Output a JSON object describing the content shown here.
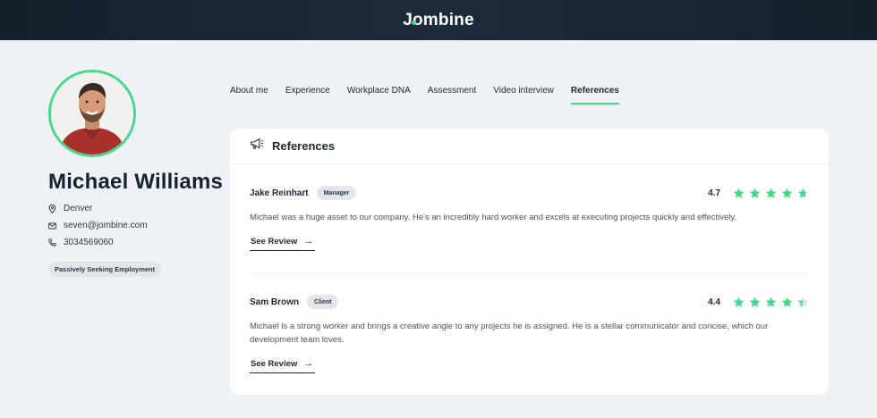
{
  "header": {
    "logo_text": "Jombine"
  },
  "profile": {
    "name": "Michael Williams",
    "location": "Denver",
    "email": "seven@jombine.com",
    "phone": "3034569060",
    "status": "Passively Seeking Employment"
  },
  "tabs": [
    {
      "label": "About me",
      "active": false
    },
    {
      "label": "Experience",
      "active": false
    },
    {
      "label": "Workplace DNA",
      "active": false
    },
    {
      "label": "Assessment",
      "active": false
    },
    {
      "label": "Video interview",
      "active": false
    },
    {
      "label": "References",
      "active": true
    }
  ],
  "references": {
    "title": "References",
    "items": [
      {
        "name": "Jake Reinhart",
        "role": "Manager",
        "rating": "4.7",
        "rating_value": 4.7,
        "text": "Michael was a huge asset to our company. He's an incredibly hard worker and excels at executing projects quickly and effectively.",
        "link_label": "See Review"
      },
      {
        "name": "Sam Brown",
        "role": "Client",
        "rating": "4.4",
        "rating_value": 4.4,
        "text": "Michael is a strong worker and brings a creative angle to any projects he is assigned. He is a stellar communicator and concise, which our development team loves.",
        "link_label": "See Review"
      }
    ]
  },
  "colors": {
    "accent": "#3ddc84",
    "header_bg": "#17222f",
    "star_empty": "#d9dde2"
  },
  "icons": {
    "location": "map-pin-icon",
    "email": "envelope-icon",
    "phone": "phone-icon",
    "references": "megaphone-icon",
    "star": "star-icon",
    "arrow": "arrow-right-icon"
  }
}
